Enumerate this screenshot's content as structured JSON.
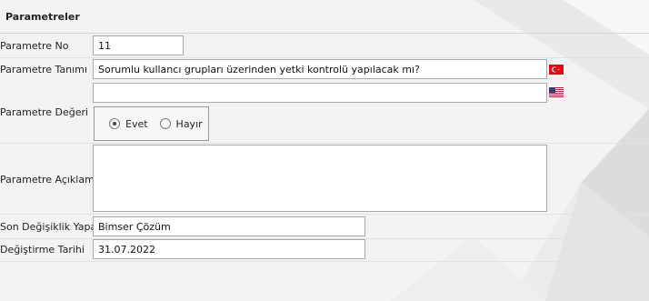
{
  "panel": {
    "title": "Parametreler"
  },
  "form": {
    "param_no": {
      "label": "Parametre No",
      "value": "11"
    },
    "param_tanimi": {
      "label": "Parametre Tanımı",
      "value_tr": "Sorumlu kullancı grupları üzerinden yetki kontrolü yapılacak mı?",
      "value_en": ""
    },
    "param_degeri": {
      "label": "Parametre Değeri",
      "options": [
        "Evet",
        "Hayır"
      ],
      "selected": "Evet"
    },
    "param_aciklamasi": {
      "label": "Parametre Açıklaması",
      "value": ""
    },
    "son_degisiklik": {
      "label": "Son Değişiklik Yapan",
      "value": "Bimser Çözüm"
    },
    "degistirme_tarihi": {
      "label": "Değiştirme Tarihi",
      "value": "31.07.2022"
    }
  },
  "flags": {
    "tr": "turkey-flag-icon",
    "en": "usa-flag-icon"
  },
  "colors": {
    "flag_red": "#e30a17",
    "border": "#a9a9a9"
  }
}
